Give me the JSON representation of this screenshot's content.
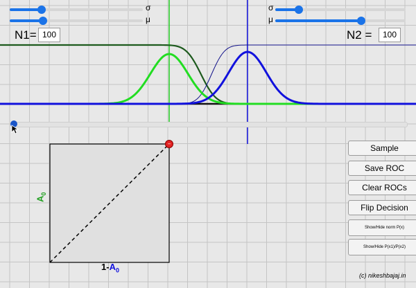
{
  "sliders": {
    "left_sigma": {
      "symbol": "σ",
      "value": 0.24
    },
    "left_mu": {
      "symbol": "μ",
      "value": 0.25
    },
    "right_sigma": {
      "symbol": "σ",
      "value": 0.18
    },
    "right_mu": {
      "symbol": "μ",
      "value": 0.66
    }
  },
  "n1": {
    "label": "N1=",
    "value": "100"
  },
  "n2": {
    "label": "N2 =",
    "value": "100"
  },
  "threshold": {
    "value": 0.0
  },
  "roc": {
    "ylabel_base": "A",
    "ylabel_sub": "0",
    "xlabel_prefix": "1-",
    "xlabel_base": "A",
    "xlabel_sub": "0"
  },
  "buttons": {
    "sample": "Sample",
    "save_roc": "Save ROC",
    "clear_rocs": "Clear ROCs",
    "flip": "Flip Decision",
    "show_norm": "Show/Hide norm P(x)",
    "show_ratio": "Show/Hide P(x1)/P(x2)"
  },
  "credit": "(c) nikeshbajaj.in",
  "colors": {
    "green": "#22dd22",
    "darkgreen": "#1d5a1d",
    "blue": "#1111dd",
    "navy": "#11118a",
    "grid": "#c4c4c4",
    "gridbg": "#e8e8e8"
  }
}
